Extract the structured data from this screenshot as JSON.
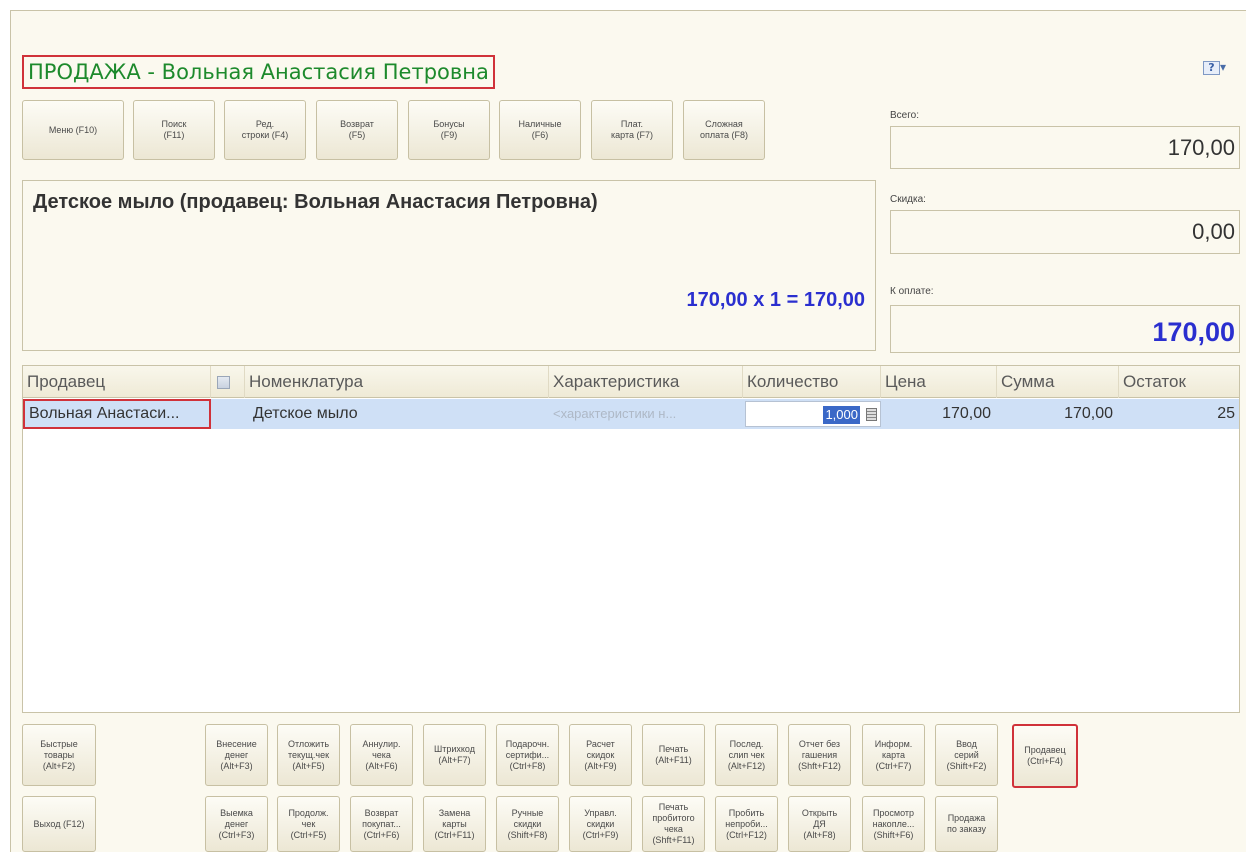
{
  "title": "ПРОДАЖА - Вольная Анастасия Петровна",
  "help_icon": "?",
  "toolbar": [
    {
      "label": "Меню (F10)"
    },
    {
      "label": "Поиск\n(F11)"
    },
    {
      "label": "Ред.\nстроки (F4)"
    },
    {
      "label": "Возврат\n(F5)"
    },
    {
      "label": "Бонусы\n(F9)"
    },
    {
      "label": "Наличные\n(F6)"
    },
    {
      "label": "Плат.\nкарта (F7)"
    },
    {
      "label": "Сложная\nоплата (F8)"
    }
  ],
  "info": {
    "product_line": "Детское мыло (продавец: Вольная Анастасия Петровна)",
    "calc_line": "170,00  x 1  = 170,00"
  },
  "summary": {
    "total_label": "Всего:",
    "total_value": "170,00",
    "discount_label": "Скидка:",
    "discount_value": "0,00",
    "pay_label": "К оплате:",
    "pay_value": "170,00"
  },
  "grid": {
    "headers": {
      "seller": "Продавец",
      "nomenclature": "Номенклатура",
      "characteristic": "Характеристика",
      "quantity": "Количество",
      "price": "Цена",
      "sum": "Сумма",
      "rest": "Остаток"
    },
    "rows": [
      {
        "seller": "Вольная Анастаси...",
        "nomenclature": "Детское мыло",
        "characteristic": "<характеристики н...",
        "quantity": "1,000",
        "price": "170,00",
        "sum": "170,00",
        "rest": "25"
      }
    ]
  },
  "bottom_row1": [
    {
      "label": "Быстрые\nтовары\n(Alt+F2)"
    },
    {
      "label": "Внесение\nденег\n(Alt+F3)"
    },
    {
      "label": "Отложить\nтекущ.чек\n(Alt+F5)"
    },
    {
      "label": "Аннулир.\nчека\n(Alt+F6)"
    },
    {
      "label": "Штрихкод\n(Alt+F7)"
    },
    {
      "label": "Подарочн.\nсертифи...\n(Ctrl+F8)"
    },
    {
      "label": "Расчет\nскидок\n(Alt+F9)"
    },
    {
      "label": "Печать\n(Alt+F11)"
    },
    {
      "label": "Послед.\nслип чек\n(Alt+F12)"
    },
    {
      "label": "Отчет без\nгашения\n(Shft+F12)"
    },
    {
      "label": "Информ.\nкарта\n(Ctrl+F7)"
    },
    {
      "label": "Ввод\nсерий\n(Shift+F2)"
    },
    {
      "label": "Продавец\n(Ctrl+F4)"
    }
  ],
  "bottom_row2": [
    {
      "label": "Выход (F12)"
    },
    {
      "label": "Выемка\nденег\n(Ctrl+F3)"
    },
    {
      "label": "Продолж.\nчек\n(Ctrl+F5)"
    },
    {
      "label": "Возврат\nпокупат...\n(Ctrl+F6)"
    },
    {
      "label": "Замена\nкарты\n(Ctrl+F11)"
    },
    {
      "label": "Ручные\nскидки\n(Shift+F8)"
    },
    {
      "label": "Управл.\nскидки\n(Ctrl+F9)"
    },
    {
      "label": "Печать\nпробитого\nчека\n(Shft+F11)"
    },
    {
      "label": "Пробить\nнепроби...\n(Ctrl+F12)"
    },
    {
      "label": "Открыть\nДЯ\n(Alt+F8)"
    },
    {
      "label": "Просмотр\nнакопле...\n(Shift+F6)"
    },
    {
      "label": "Продажа\nпо заказу"
    }
  ]
}
